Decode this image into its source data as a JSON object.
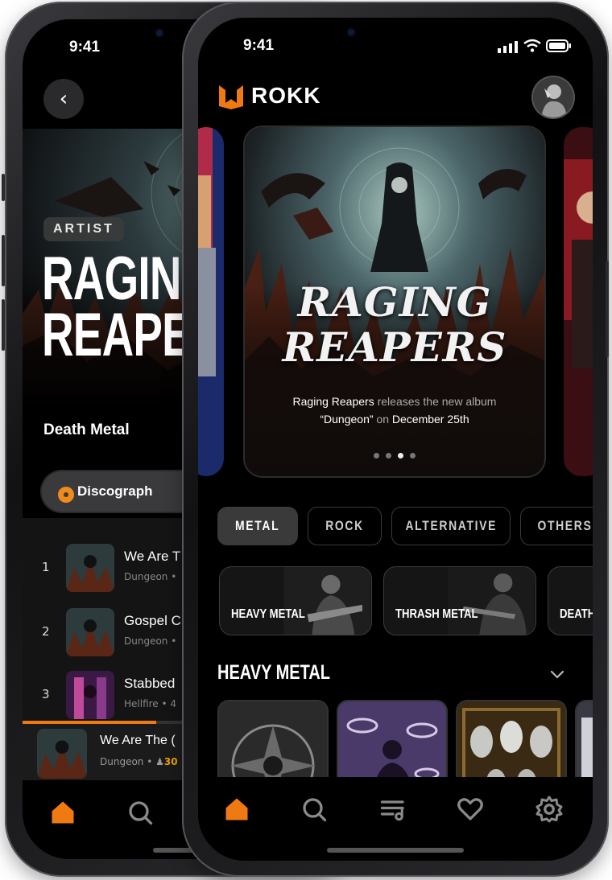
{
  "status": {
    "time_back": "9:41",
    "time_front": "9:41"
  },
  "artist_page": {
    "badge": "ARTIST",
    "title_line1": "RAGIN",
    "title_line2": "REAPE",
    "genre": "Death Metal",
    "discography_button": "Discograph",
    "tracks": [
      {
        "num": "1",
        "title": "We Are T",
        "album": "Dungeon •"
      },
      {
        "num": "2",
        "title": "Gospel C",
        "album": "Dungeon •"
      },
      {
        "num": "3",
        "title": "Stabbed",
        "album": "Hellfire • 4"
      }
    ],
    "now_playing": {
      "title": "We Are The (",
      "album": "Dungeon •",
      "listeners": "30",
      "progress": 0.42
    }
  },
  "home": {
    "brand": "ROKK",
    "feature": {
      "title_line1": "RAGING",
      "title_line2": "REAPERS",
      "desc_band": "Raging Reapers",
      "desc_mid": " releases the new album",
      "desc_album": "“Dungeon”",
      "desc_on": " on ",
      "desc_date": "December 25th",
      "page_index": 3,
      "page_count": 4
    },
    "chips": [
      "METAL",
      "ROCK",
      "ALTERNATIVE",
      "OTHERS"
    ],
    "active_chip": "METAL",
    "genre_cards": [
      "HEAVY METAL",
      "THRASH METAL",
      "DEATH"
    ],
    "section_title": "HEAVY METAL"
  },
  "colors": {
    "accent": "#f07a12",
    "background": "#000000",
    "chip_active": "#3a3a3a"
  },
  "icons": [
    "chevron-left-icon",
    "home-icon",
    "search-icon",
    "playlist-icon",
    "heart-icon",
    "settings-icon",
    "chevron-down-icon",
    "disc-icon"
  ]
}
